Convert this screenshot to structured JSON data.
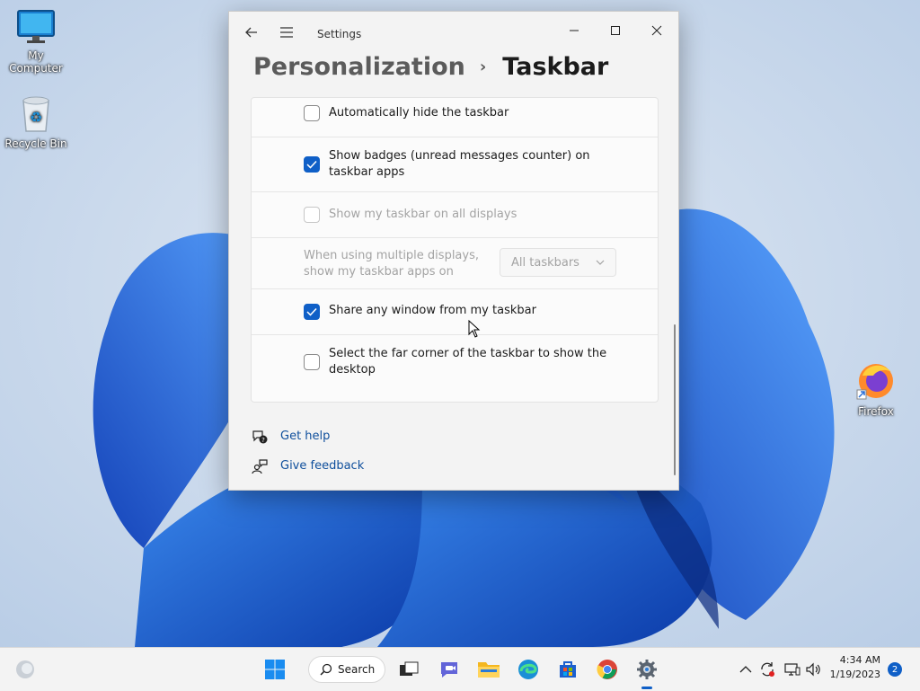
{
  "desktop": {
    "icons": [
      {
        "label": "My Computer",
        "icon": "monitor-icon"
      },
      {
        "label": "Recycle Bin",
        "icon": "recycle-bin-icon"
      },
      {
        "label": "Firefox",
        "icon": "firefox-icon"
      }
    ]
  },
  "window": {
    "title": "Settings",
    "breadcrumb": {
      "parent": "Personalization",
      "separator": "›",
      "current": "Taskbar"
    },
    "settings": [
      {
        "label": "Automatically hide the taskbar",
        "checked": false,
        "enabled": true
      },
      {
        "label": "Show badges (unread messages counter) on taskbar apps",
        "checked": true,
        "enabled": true
      },
      {
        "label": "Show my taskbar on all displays",
        "checked": false,
        "enabled": false
      },
      {
        "label": "When using multiple displays, show my taskbar apps on",
        "dropdown_value": "All taskbars",
        "enabled": false
      },
      {
        "label": "Share any window from my taskbar",
        "checked": true,
        "enabled": true
      },
      {
        "label": "Select the far corner of the taskbar to show the desktop",
        "checked": false,
        "enabled": true
      }
    ],
    "links": [
      {
        "label": "Get help",
        "icon": "help-chat-icon"
      },
      {
        "label": "Give feedback",
        "icon": "feedback-icon"
      }
    ]
  },
  "taskbar": {
    "search_label": "Search",
    "apps": [
      "start-icon",
      "search",
      "task-view-icon",
      "teams-chat-icon",
      "file-explorer-icon",
      "edge-icon",
      "store-icon",
      "chrome-icon",
      "settings-icon"
    ],
    "active_app": "settings",
    "tray_icons": [
      "chevron-up-icon",
      "sync-icon",
      "network-icon",
      "volume-icon"
    ],
    "time": "4:34 AM",
    "date": "1/19/2023",
    "notification_count": "2"
  },
  "colors": {
    "accent": "#0f5fc7",
    "link": "#0f4f9c"
  }
}
